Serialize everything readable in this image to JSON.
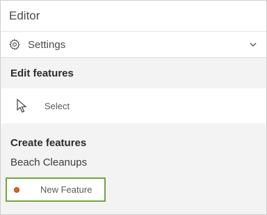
{
  "header": {
    "title": "Editor"
  },
  "settings": {
    "label": "Settings",
    "icon": "gear-icon",
    "chevron": "chevron-down-icon"
  },
  "edit_features": {
    "heading": "Edit features",
    "select": {
      "label": "Select",
      "icon": "pointer-cursor-icon"
    }
  },
  "create_features": {
    "heading": "Create features",
    "layer": "Beach Cleanups",
    "template": {
      "label": "New Feature",
      "symbol_color": "#e0621e",
      "highlight_color": "#6fa63f"
    }
  }
}
